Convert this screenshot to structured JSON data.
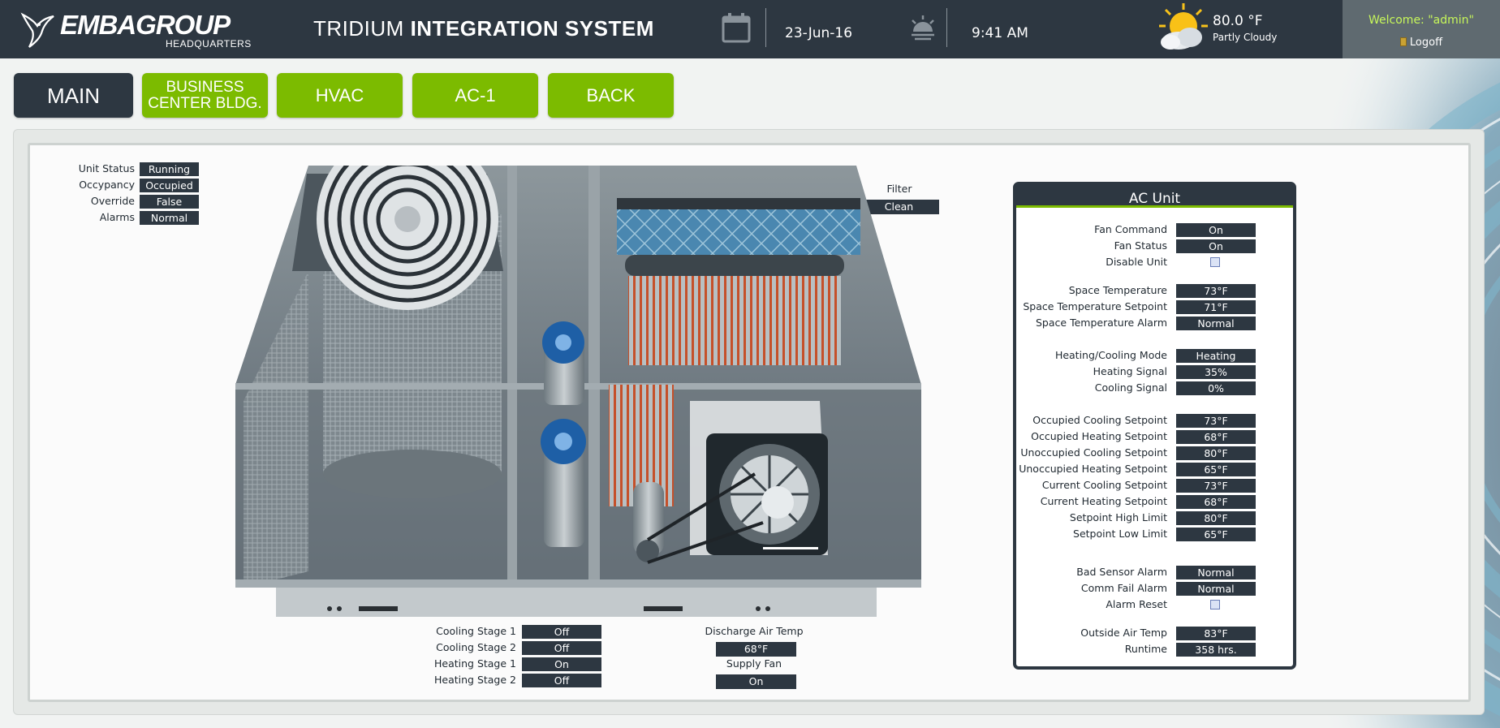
{
  "header": {
    "logo_main": "EMBAGROUP",
    "logo_sub": "HEADQUARTERS",
    "title_light": "TRIDIUM",
    "title_bold": "INTEGRATION SYSTEM",
    "date": "23-Jun-16",
    "time": "9:41 AM",
    "temperature": "80.0 °F",
    "condition": "Partly Cloudy",
    "welcome": "Welcome: \"admin\"",
    "logoff": "Logoff",
    "icons": [
      "calendar-icon",
      "sunrise-icon",
      "partly-cloudy-icon",
      "logoff-door-icon"
    ]
  },
  "nav": {
    "main": "MAIN",
    "business_line1": "BUSINESS",
    "business_line2": "CENTER BLDG.",
    "hvac": "HVAC",
    "ac1": "AC-1",
    "back": "BACK"
  },
  "status": [
    {
      "label": "Unit Status",
      "value": "Running"
    },
    {
      "label": "Occypancy",
      "value": "Occupied"
    },
    {
      "label": "Override",
      "value": "False"
    },
    {
      "label": "Alarms",
      "value": "Normal"
    }
  ],
  "filter": {
    "label": "Filter",
    "value": "Clean"
  },
  "stages": [
    {
      "label": "Cooling Stage 1",
      "value": "Off"
    },
    {
      "label": "Cooling Stage 2",
      "value": "Off"
    },
    {
      "label": "Heating Stage 1",
      "value": "On"
    },
    {
      "label": "Heating Stage 2",
      "value": "Off"
    }
  ],
  "discharge": {
    "label": "Discharge Air Temp",
    "value": "68°F"
  },
  "supply_fan": {
    "label": "Supply Fan",
    "value": "On"
  },
  "ac_unit": {
    "title": "AC Unit",
    "fan_command": {
      "label": "Fan Command",
      "value": "On"
    },
    "fan_status": {
      "label": "Fan Status",
      "value": "On"
    },
    "disable_unit": {
      "label": "Disable Unit",
      "checked": false
    },
    "space_temp": {
      "label": "Space Temperature",
      "value": "73°F"
    },
    "space_setpoint": {
      "label": "Space Temperature Setpoint",
      "value": "71°F"
    },
    "space_alarm": {
      "label": "Space Temperature Alarm",
      "value": "Normal"
    },
    "mode": {
      "label": "Heating/Cooling Mode",
      "value": "Heating"
    },
    "heating_signal": {
      "label": "Heating Signal",
      "value": "35%"
    },
    "cooling_signal": {
      "label": "Cooling Signal",
      "value": "0%"
    },
    "occ_cool": {
      "label": "Occupied Cooling Setpoint",
      "value": "73°F"
    },
    "occ_heat": {
      "label": "Occupied Heating Setpoint",
      "value": "68°F"
    },
    "unocc_cool": {
      "label": "Unoccupied Cooling Setpoint",
      "value": "80°F"
    },
    "unocc_heat": {
      "label": "Unoccupied Heating Setpoint",
      "value": "65°F"
    },
    "cur_cool": {
      "label": "Current Cooling Setpoint",
      "value": "73°F"
    },
    "cur_heat": {
      "label": "Current Heating Setpoint",
      "value": "68°F"
    },
    "high_limit": {
      "label": "Setpoint High Limit",
      "value": "80°F"
    },
    "low_limit": {
      "label": "Setpoint Low Limit",
      "value": "65°F"
    },
    "bad_sensor": {
      "label": "Bad Sensor Alarm",
      "value": "Normal"
    },
    "comm_fail": {
      "label": "Comm Fail Alarm",
      "value": "Normal"
    },
    "alarm_reset": {
      "label": "Alarm Reset",
      "checked": false
    },
    "outside_air": {
      "label": "Outside Air Temp",
      "value": "83°F"
    },
    "runtime": {
      "label": "Runtime",
      "value": "358 hrs."
    }
  },
  "colors": {
    "dark": "#2d3741",
    "accent": "#7cbb00",
    "welcome": "#c7f75a"
  }
}
